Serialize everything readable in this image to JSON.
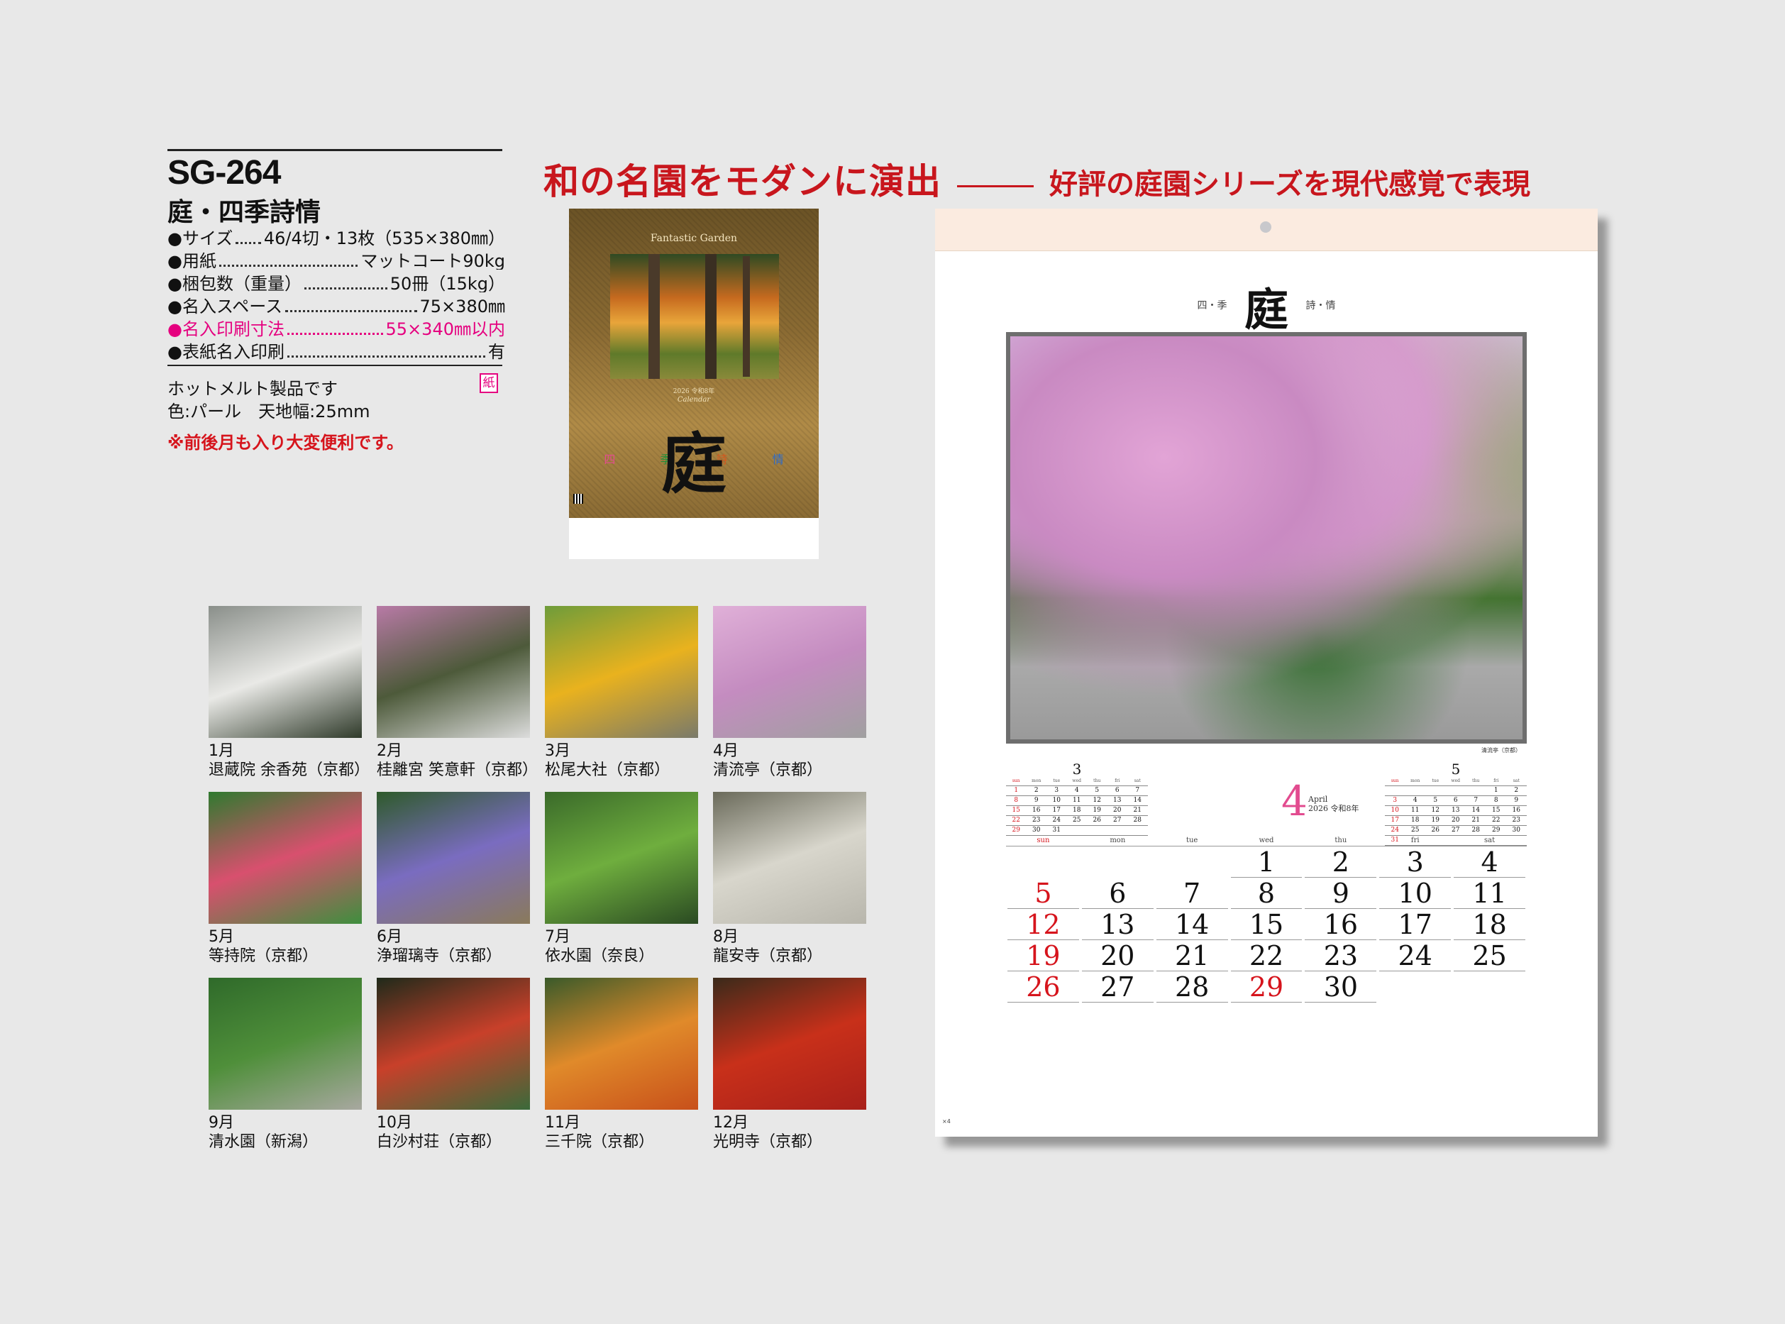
{
  "product": {
    "code": "SG-264",
    "name": "庭・四季詩情",
    "specs": [
      {
        "label": "●サイズ",
        "dots": "････",
        "value": "46/4切・13枚（535×380㎜）",
        "highlight": false
      },
      {
        "label": "●用紙",
        "dots": "",
        "value": "マットコート90kg",
        "highlight": false
      },
      {
        "label": "●梱包数（重量）",
        "dots": "",
        "value": "50冊（15kg）",
        "highlight": false
      },
      {
        "label": "●名入スペース",
        "dots": "",
        "value": "75×380㎜",
        "highlight": true,
        "color": "#111111"
      },
      {
        "label": "●名入印刷寸法",
        "dots": "",
        "value": "55×340㎜以内",
        "highlight": true,
        "color": "#e5007f"
      },
      {
        "label": "●表紙名入印刷",
        "dots": "",
        "value": "有",
        "highlight": false
      }
    ],
    "notes": [
      "ホットメルト製品です",
      "色:パール　天地幅:25mm"
    ],
    "badge": "紙",
    "red_note": "※前後月も入り大変便利です。"
  },
  "headline": {
    "main": "和の名園をモダンに演出",
    "sub": "好評の庭園シリーズを現代感覚で表現",
    "color": "#c8161d"
  },
  "cover": {
    "title": "Fantastic Garden",
    "year_line": "2026 令和8年",
    "calendar_word": "Calendar",
    "kanji": "庭",
    "four": [
      "四",
      "季",
      "詩",
      "情"
    ]
  },
  "thumbnails": [
    {
      "month": "1月",
      "place": "退蔵院 余香苑（京都）",
      "colors": [
        "#8a8f8a",
        "#e9e9e6",
        "#2f3a2a"
      ]
    },
    {
      "month": "2月",
      "place": "桂離宮 笑意軒（京都）",
      "colors": [
        "#b87aa6",
        "#4d5a3a",
        "#dcdcdc"
      ]
    },
    {
      "month": "3月",
      "place": "松尾大社（京都）",
      "colors": [
        "#6e9c3a",
        "#e9b21e",
        "#7a7a6a"
      ]
    },
    {
      "month": "4月",
      "place": "清流亭（京都）",
      "colors": [
        "#e0b0d8",
        "#c48cc0",
        "#a0a0a0"
      ]
    },
    {
      "month": "5月",
      "place": "等持院（京都）",
      "colors": [
        "#2f7a2f",
        "#d8506e",
        "#3e8f3e"
      ]
    },
    {
      "month": "6月",
      "place": "浄瑠璃寺（京都）",
      "colors": [
        "#2e5a2a",
        "#7a6cc0",
        "#8a7a5a"
      ]
    },
    {
      "month": "7月",
      "place": "依水園（奈良）",
      "colors": [
        "#3a6a2a",
        "#6fae3e",
        "#2a4a22"
      ]
    },
    {
      "month": "8月",
      "place": "龍安寺（京都）",
      "colors": [
        "#6a6a5a",
        "#d8d6cc",
        "#b8b6ac"
      ]
    },
    {
      "month": "9月",
      "place": "清水園（新潟）",
      "colors": [
        "#2f6a2a",
        "#4f8f3a",
        "#a8a8a0"
      ]
    },
    {
      "month": "10月",
      "place": "白沙村荘（京都）",
      "colors": [
        "#1f2a1a",
        "#c8402a",
        "#3a6a3a"
      ]
    },
    {
      "month": "11月",
      "place": "三千院（京都）",
      "colors": [
        "#3a5a2a",
        "#e08a2a",
        "#c8501a"
      ]
    },
    {
      "month": "12月",
      "place": "光明寺（京都）",
      "colors": [
        "#3a2a1a",
        "#c8301a",
        "#a8201a"
      ]
    }
  ],
  "calendar": {
    "header": [
      "四",
      "季",
      "庭",
      "詩",
      "情"
    ],
    "photo_caption": "清流亭（京都）",
    "month_number": "4",
    "month_en": "April",
    "month_sub": "2026 令和8年",
    "weekdays": [
      "sun",
      "mon",
      "tue",
      "wed",
      "thu",
      "fri",
      "sat"
    ],
    "weeks": [
      [
        "",
        "",
        "",
        "1",
        "2",
        "3",
        "4"
      ],
      [
        "5",
        "6",
        "7",
        "8",
        "9",
        "10",
        "11"
      ],
      [
        "12",
        "13",
        "14",
        "15",
        "16",
        "17",
        "18"
      ],
      [
        "19",
        "20",
        "21",
        "22",
        "23",
        "24",
        "25"
      ],
      [
        "26",
        "27",
        "28",
        "29",
        "30",
        "",
        ""
      ]
    ],
    "holidays": [
      "29"
    ],
    "prev": {
      "title": "3",
      "rows": [
        [
          "1",
          "2",
          "3",
          "4",
          "5",
          "6",
          "7"
        ],
        [
          "8",
          "9",
          "10",
          "11",
          "12",
          "13",
          "14"
        ],
        [
          "15",
          "16",
          "17",
          "18",
          "19",
          "20",
          "21"
        ],
        [
          "22",
          "23",
          "24",
          "25",
          "26",
          "27",
          "28"
        ],
        [
          "29",
          "30",
          "31",
          "",
          "",
          "",
          ""
        ]
      ]
    },
    "next": {
      "title": "5",
      "rows": [
        [
          "",
          "",
          "",
          "",
          "",
          "1",
          "2"
        ],
        [
          "3",
          "4",
          "5",
          "6",
          "7",
          "8",
          "9"
        ],
        [
          "10",
          "11",
          "12",
          "13",
          "14",
          "15",
          "16"
        ],
        [
          "17",
          "18",
          "19",
          "20",
          "21",
          "22",
          "23"
        ],
        [
          "24",
          "25",
          "26",
          "27",
          "28",
          "29",
          "30"
        ],
        [
          "31",
          "",
          "",
          "",
          "",
          "",
          ""
        ]
      ]
    },
    "page_no": "×4"
  }
}
